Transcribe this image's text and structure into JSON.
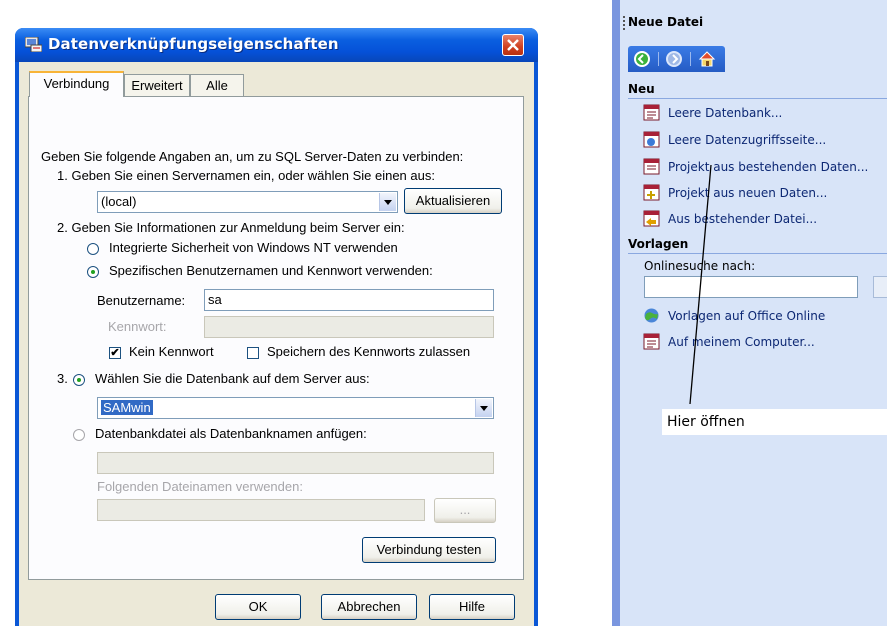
{
  "dialog": {
    "title": "Datenverknüpfungseigenschaften",
    "tabs": [
      "Verbindung",
      "Erweitert",
      "Alle"
    ],
    "intro": "Geben Sie folgende Angaben an, um zu SQL Server-Daten zu verbinden:",
    "step1_label": "1. Geben Sie einen Servernamen ein, oder wählen Sie einen aus:",
    "server_value": "(local)",
    "refresh_button": "Aktualisieren",
    "step2_label": "2. Geben Sie Informationen zur Anmeldung beim Server ein:",
    "radio_nt": "Integrierte Sicherheit von Windows NT verwenden",
    "radio_specific": "Spezifischen Benutzernamen und Kennwort verwenden:",
    "username_label": "Benutzername:",
    "username_value": "sa",
    "password_label": "Kennwort:",
    "no_password_label": "Kein Kennwort",
    "save_password_label": "Speichern des Kennworts zulassen",
    "step3_num": "3.",
    "radio_select_db": "Wählen Sie die Datenbank auf dem Server aus:",
    "database_value": "SAMwin",
    "radio_attach": "Datenbankdatei als Datenbanknamen anfügen:",
    "filename_label": "Folgenden Dateinamen verwenden:",
    "browse_button": "...",
    "test_button": "Verbindung testen",
    "ok_button": "OK",
    "cancel_button": "Abbrechen",
    "help_button": "Hilfe"
  },
  "taskpane": {
    "title": "Neue Datei",
    "section_new": "Neu",
    "new_items": [
      "Leere Datenbank...",
      "Leere Datenzugriffsseite...",
      "Projekt aus bestehenden Daten...",
      "Projekt aus neuen Daten...",
      "Aus bestehender Datei..."
    ],
    "section_templates": "Vorlagen",
    "search_label": "Onlinesuche nach:",
    "template_items": [
      "Vorlagen auf Office Online",
      "Auf meinem Computer..."
    ]
  },
  "annotation": "Hier öffnen"
}
